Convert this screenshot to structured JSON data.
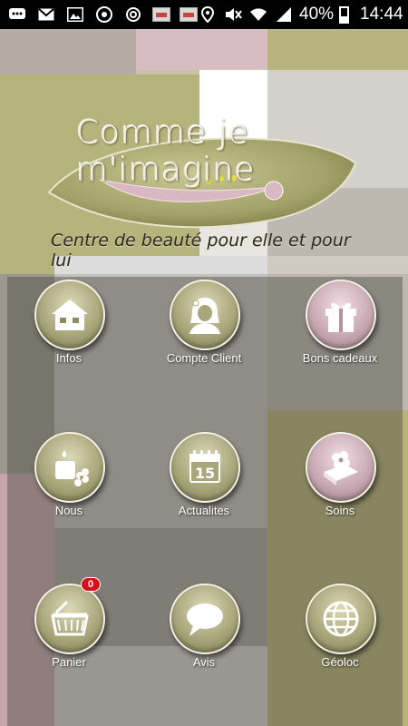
{
  "status_bar": {
    "battery": "40%",
    "time": "14:44",
    "left_icons": [
      "chat-icon",
      "gmail-icon",
      "gallery-icon",
      "chrome-icon",
      "sync-icon",
      "thumbnail-icon",
      "thumbnail-icon"
    ],
    "right_icons": [
      "location-icon",
      "mute-icon",
      "wifi-icon",
      "signal-icon",
      "battery-icon"
    ]
  },
  "logo": {
    "title": "Comme je m'imagine",
    "subtitle": "Centre de beauté pour elle et pour lui"
  },
  "menu": {
    "infos": "Infos",
    "compte_client": "Compte Client",
    "bons_cadeaux": "Bons cadeaux",
    "nous": "Nous",
    "actualites": "Actualites",
    "calendar_day": "15",
    "soins": "Soins",
    "panier": "Panier",
    "panier_badge": "0",
    "avis": "Avis",
    "geoloc": "Géoloc"
  },
  "colors": {
    "olive": "#b4b37a",
    "pink": "#d8bfc5",
    "badge": "#d4121a"
  }
}
